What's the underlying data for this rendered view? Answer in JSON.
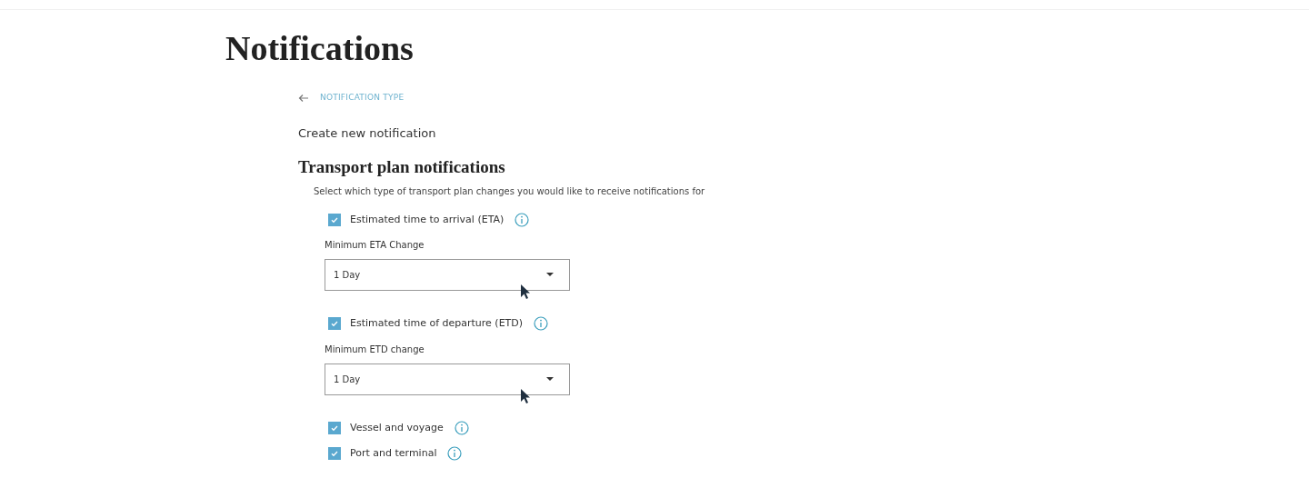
{
  "page_title": "Notifications",
  "back_link": {
    "label": "NOTIFICATION TYPE"
  },
  "subtitle": "Create new notification",
  "section": {
    "title": "Transport plan notifications",
    "description": "Select which type of transport plan changes you would like to receive notifications for"
  },
  "options": [
    {
      "label": "Estimated time to arrival (ETA)",
      "checked": true,
      "dropdown": {
        "label": "Minimum ETA Change",
        "value": "1 Day"
      }
    },
    {
      "label": "Estimated time of departure (ETD)",
      "checked": true,
      "dropdown": {
        "label": "Minimum ETD change",
        "value": "1 Day"
      }
    },
    {
      "label": "Vessel and voyage",
      "checked": true
    },
    {
      "label": "Port and terminal",
      "checked": true
    }
  ]
}
